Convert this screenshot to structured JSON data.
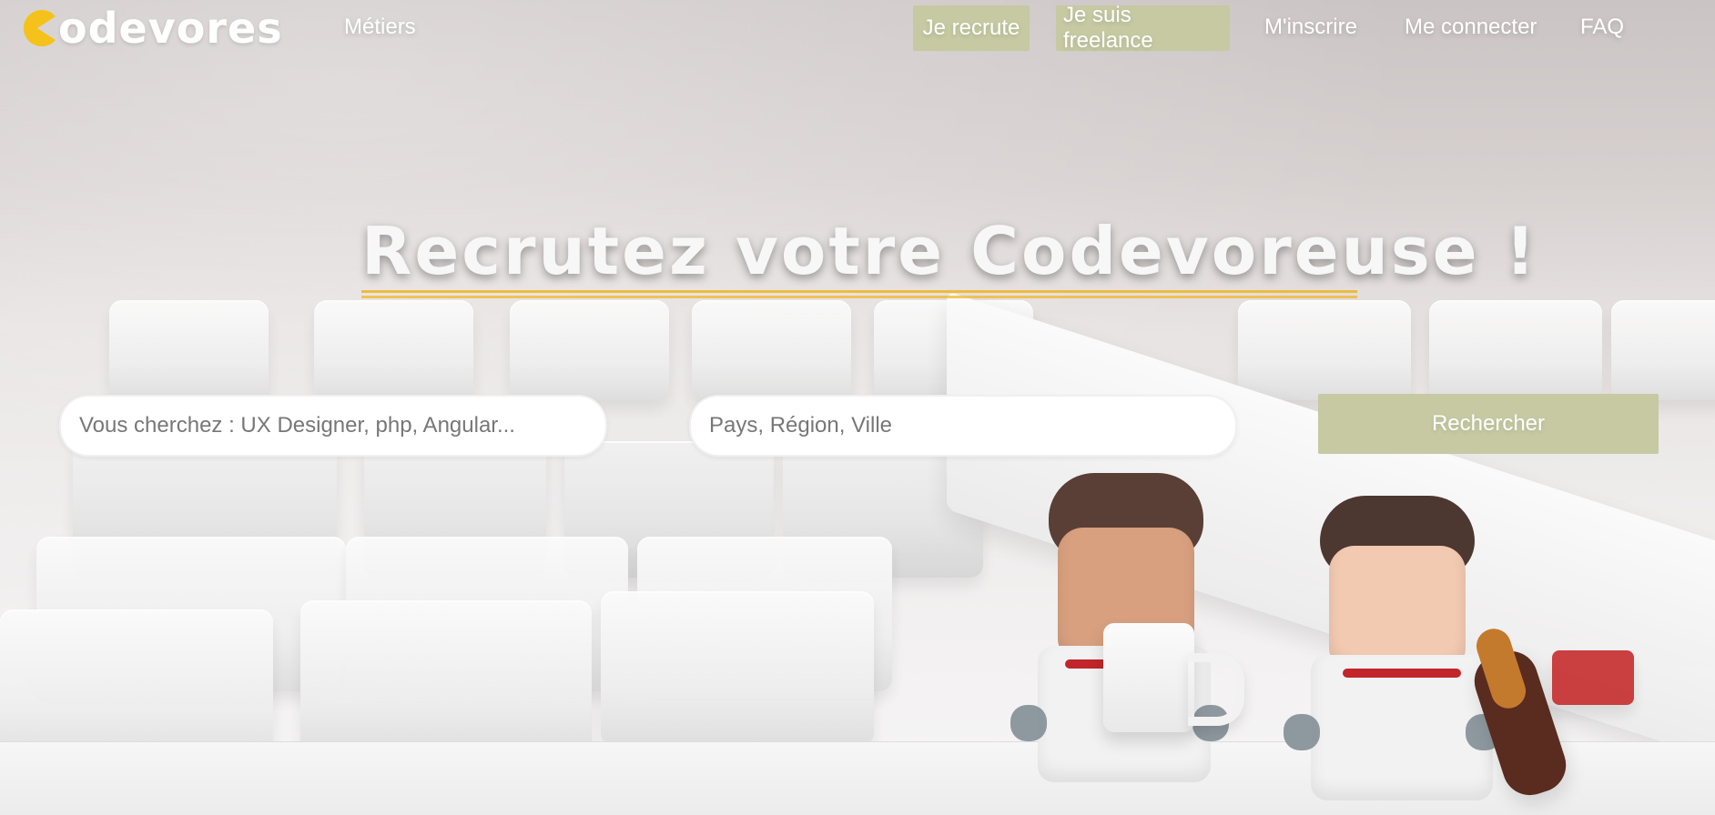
{
  "brand": {
    "logo_text": "odevores",
    "logo_mark_color": "#f4c21a"
  },
  "nav": {
    "metiers": "Métiers",
    "cta_recruit": "Je recrute",
    "cta_freelance": "Je suis freelance",
    "signup": "M'inscrire",
    "login": "Me connecter",
    "faq": "FAQ",
    "cta_bg": "#c6c9a2"
  },
  "hero": {
    "title": "Recrutez votre Codevoreuse !",
    "underline_color": "#f1b62a"
  },
  "search": {
    "query_placeholder": "Vous cherchez : UX Designer, php, Angular...",
    "location_placeholder": "Pays, Région, Ville",
    "button_label": "Rechercher"
  }
}
